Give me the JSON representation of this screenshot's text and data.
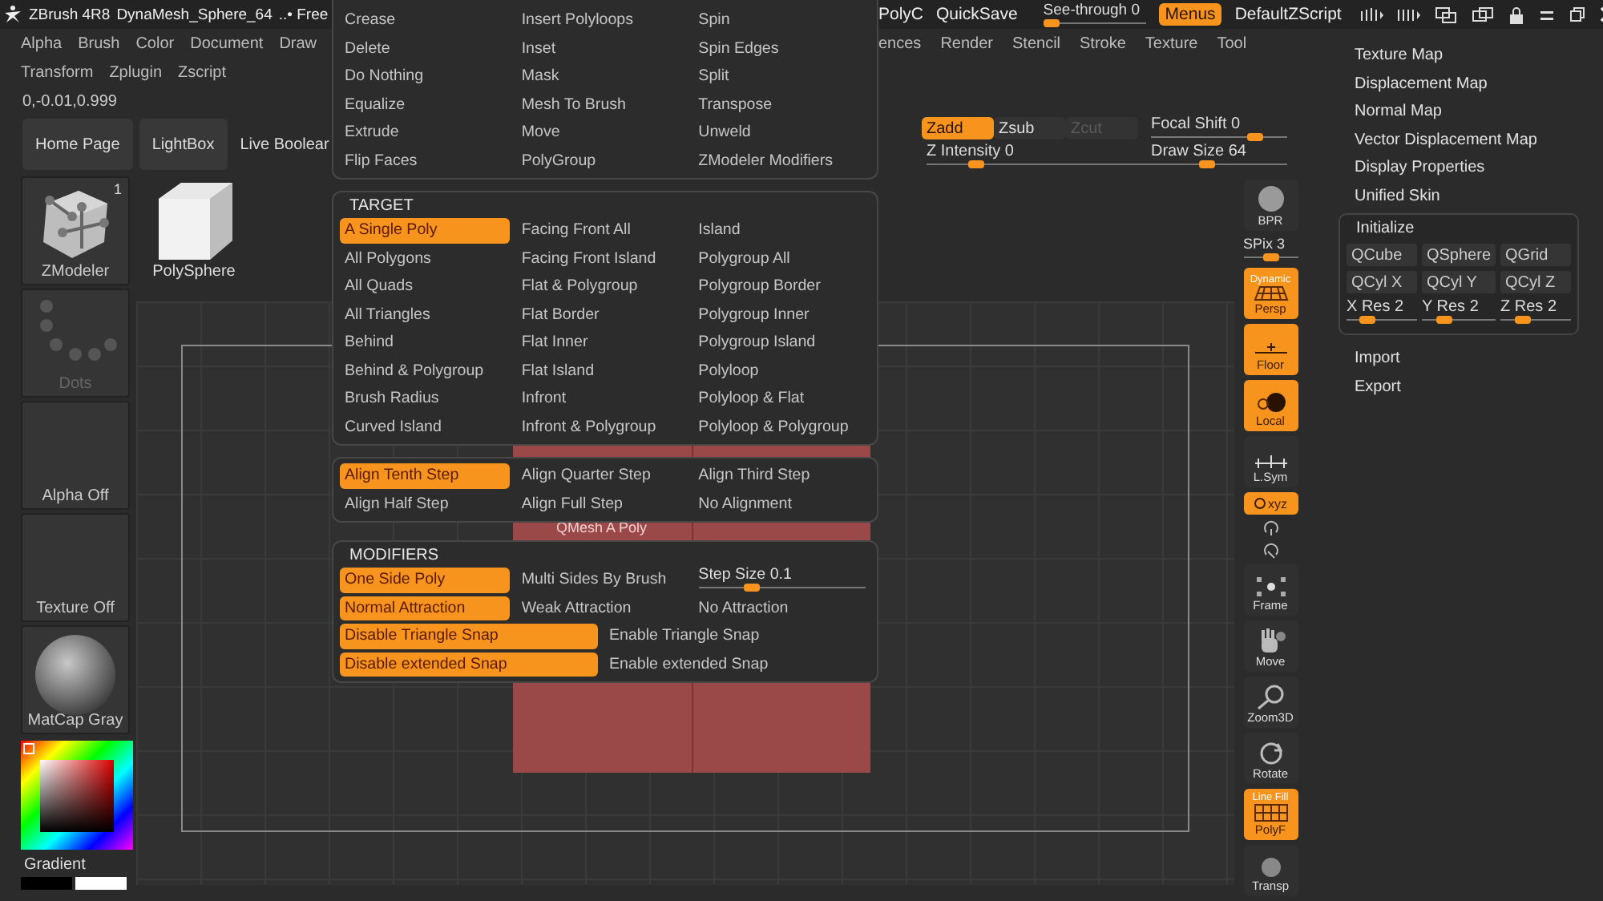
{
  "title_bar": {
    "app": "ZBrush 4R8",
    "document": "DynaMesh_Sphere_64",
    "memory": "..• Free",
    "right_items": [
      "PolyC",
      "QuickSave"
    ],
    "see_through": {
      "label": "See-through",
      "value": "0",
      "level": 0
    },
    "menus": {
      "label": "Menus",
      "on": true
    },
    "script": "DefaultZScript"
  },
  "menu_bar": {
    "left_items": [
      "Alpha",
      "Brush",
      "Color",
      "Document",
      "Draw"
    ],
    "right_items": [
      "ences",
      "Render",
      "Stencil",
      "Stroke",
      "Texture",
      "Tool"
    ],
    "second_row": [
      "Transform",
      "Zplugin",
      "Zscript"
    ]
  },
  "coordinates": "0,-0.01,0.999",
  "shelf": {
    "buttons": [
      "Home Page",
      "LightBox"
    ],
    "cut_button": "Live Boolear",
    "modes": [
      {
        "label": "Zadd",
        "selected": true,
        "disabled": false
      },
      {
        "label": "Zsub",
        "selected": false,
        "disabled": false
      },
      {
        "label": "Zcut",
        "selected": false,
        "disabled": true
      }
    ],
    "sliders": [
      {
        "label": "Focal Shift",
        "value": "0",
        "level": 0.8
      },
      {
        "label": "Z Intensity",
        "value": "0",
        "level": 0.2
      },
      {
        "label": "Draw Size",
        "value": "64",
        "level": 0.4
      }
    ]
  },
  "palette": [
    {
      "kind": "brush",
      "label": "ZModeler",
      "badge": "1"
    },
    {
      "kind": "stroke",
      "label": "Dots"
    },
    {
      "kind": "alpha",
      "label": "Alpha Off"
    },
    {
      "kind": "texture",
      "label": "Texture Off"
    },
    {
      "kind": "material",
      "label": "MatCap Gray"
    }
  ],
  "color_picker": {
    "label": "Gradient"
  },
  "current_tool": "PolySphere",
  "canvas": {
    "label": "QMesh A Poly"
  },
  "view_controls": [
    {
      "kind": "button",
      "label": "BPR",
      "on": false
    },
    {
      "kind": "slider",
      "label": "SPix",
      "value": "3",
      "level": 0.5
    },
    {
      "kind": "button",
      "label": "Persp",
      "on": true,
      "caption": "Dynamic"
    },
    {
      "kind": "button",
      "label": "Floor",
      "on": true
    },
    {
      "kind": "button",
      "label": "Local",
      "on": true
    },
    {
      "kind": "button",
      "label": "L.Sym",
      "on": false
    },
    {
      "kind": "small",
      "label": "xyz",
      "on": true
    },
    {
      "kind": "icon"
    },
    {
      "kind": "icon"
    },
    {
      "kind": "button",
      "label": "Frame",
      "on": false
    },
    {
      "kind": "button",
      "label": "Move",
      "on": false
    },
    {
      "kind": "button",
      "label": "Zoom3D",
      "on": false
    },
    {
      "kind": "button",
      "label": "Rotate",
      "on": false
    },
    {
      "kind": "button",
      "label": "PolyF",
      "on": true,
      "caption": "Line Fill"
    },
    {
      "kind": "button",
      "label": "Transp",
      "on": false
    }
  ],
  "tool_menu": {
    "items_top": [
      "Texture Map",
      "Displacement Map",
      "Normal Map",
      "Vector Displacement Map",
      "Display Properties",
      "Unified Skin"
    ],
    "initialize": {
      "title": "Initialize",
      "buttons": [
        "QCube",
        "QSphere",
        "QGrid",
        "QCyl X",
        "QCyl Y",
        "QCyl Z"
      ],
      "sliders": [
        {
          "label": "X Res",
          "value": "2",
          "level": 0.25
        },
        {
          "label": "Y Res",
          "value": "2",
          "level": 0.25
        },
        {
          "label": "Z Res",
          "value": "2",
          "level": 0.25
        }
      ]
    },
    "items_bottom": [
      "Import",
      "Export"
    ]
  },
  "zmodeler_menu": {
    "actions": [
      "Crease",
      "Insert Polyloops",
      "Spin",
      "Delete",
      "Inset",
      "Spin Edges",
      "Do Nothing",
      "Mask",
      "Split",
      "Equalize",
      "Mesh To Brush",
      "Transpose",
      "Extrude",
      "Move",
      "Unweld",
      "Flip Faces",
      "PolyGroup",
      "ZModeler Modifiers"
    ],
    "target": {
      "title": "TARGET",
      "options": [
        {
          "label": "A Single Poly",
          "selected": true
        },
        {
          "label": "Facing Front All",
          "selected": false
        },
        {
          "label": "Island",
          "selected": false
        },
        {
          "label": "All Polygons",
          "selected": false
        },
        {
          "label": "Facing Front Island",
          "selected": false
        },
        {
          "label": "Polygroup All",
          "selected": false
        },
        {
          "label": "All Quads",
          "selected": false
        },
        {
          "label": "Flat & Polygroup",
          "selected": false
        },
        {
          "label": "Polygroup Border",
          "selected": false
        },
        {
          "label": "All Triangles",
          "selected": false
        },
        {
          "label": "Flat Border",
          "selected": false
        },
        {
          "label": "Polygroup Inner",
          "selected": false
        },
        {
          "label": "Behind",
          "selected": false
        },
        {
          "label": "Flat Inner",
          "selected": false
        },
        {
          "label": "Polygroup Island",
          "selected": false
        },
        {
          "label": "Behind & Polygroup",
          "selected": false
        },
        {
          "label": "Flat Island",
          "selected": false
        },
        {
          "label": "Polyloop",
          "selected": false
        },
        {
          "label": "Brush Radius",
          "selected": false
        },
        {
          "label": "Infront",
          "selected": false
        },
        {
          "label": "Polyloop & Flat",
          "selected": false
        },
        {
          "label": "Curved Island",
          "selected": false
        },
        {
          "label": "Infront & Polygroup",
          "selected": false
        },
        {
          "label": "Polyloop & Polygroup",
          "selected": false
        }
      ]
    },
    "alignment": [
      {
        "label": "Align Tenth Step",
        "selected": true
      },
      {
        "label": "Align Quarter Step",
        "selected": false
      },
      {
        "label": "Align Third Step",
        "selected": false
      },
      {
        "label": "Align Half Step",
        "selected": false
      },
      {
        "label": "Align Full Step",
        "selected": false
      },
      {
        "label": "No Alignment",
        "selected": false
      }
    ],
    "modifiers": {
      "title": "MODIFIERS",
      "rows": [
        [
          {
            "kind": "option",
            "label": "One Side Poly",
            "selected": true
          },
          {
            "kind": "option",
            "label": "Multi Sides By Brush",
            "selected": false
          },
          {
            "kind": "slider",
            "label": "Step Size",
            "value": "0.1",
            "level": 0.3
          }
        ],
        [
          {
            "kind": "option",
            "label": "Normal Attraction",
            "selected": true
          },
          {
            "kind": "option",
            "label": "Weak Attraction",
            "selected": false
          },
          {
            "kind": "option",
            "label": "No Attraction",
            "selected": false
          }
        ],
        [
          {
            "kind": "option",
            "label": "Disable Triangle Snap",
            "selected": true
          },
          {
            "kind": "option",
            "label": "Enable Triangle Snap",
            "selected": false
          }
        ],
        [
          {
            "kind": "option",
            "label": "Disable extended Snap",
            "selected": true
          },
          {
            "kind": "option",
            "label": "Enable extended Snap",
            "selected": false
          }
        ]
      ]
    }
  }
}
